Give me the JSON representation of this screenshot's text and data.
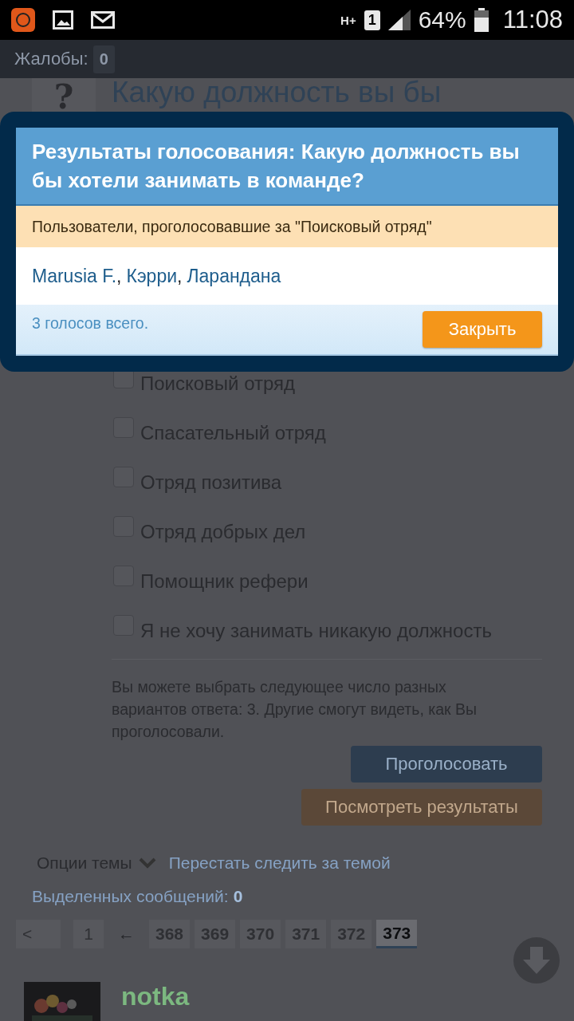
{
  "status_bar": {
    "network": "H+",
    "sim": "1",
    "battery": "64%",
    "time": "11:08"
  },
  "page": {
    "complaints_label": "Жалобы:",
    "complaints_count": "0",
    "question_mark": "?",
    "poll_question": "Какую должность вы бы",
    "options": [
      {
        "label": "Поисковый отряд",
        "checked": false
      },
      {
        "label": "Спасательный отряд",
        "checked": false
      },
      {
        "label": "Отряд позитива",
        "checked": false
      },
      {
        "label": "Отряд добрых дел",
        "checked": false
      },
      {
        "label": "Помощник рефери",
        "checked": false
      },
      {
        "label": "Я не хочу занимать никакую должность",
        "checked": false
      }
    ],
    "info": "Вы можете выбрать следующее число разных вариантов ответа: 3. Другие смогут видеть, как Вы проголосовали.",
    "vote_button": "Проголосовать",
    "results_button": "Посмотреть результаты",
    "thread_options": "Опции темы",
    "unfollow_link": "Перестать следить за темой",
    "selected_label": "Выделенных сообщений:",
    "selected_count": "0",
    "pagination": {
      "prev": "<",
      "first": "1",
      "jump": "←",
      "pages": [
        {
          "label": "368",
          "selected": false
        },
        {
          "label": "369",
          "selected": false
        },
        {
          "label": "370",
          "selected": false
        },
        {
          "label": "371",
          "selected": false
        },
        {
          "label": "372",
          "selected": false
        },
        {
          "label": "373",
          "selected": true
        }
      ]
    },
    "post_author": "notka"
  },
  "dialog": {
    "title": "Результаты голосования: Какую должность вы бы хотели занимать в команде?",
    "subtitle": "Пользователи, проголосовавшие за \"Поисковый отряд\"",
    "voters": [
      {
        "name": "Marusia F.",
        "separator": ","
      },
      {
        "name": "Кэрри",
        "separator": ","
      },
      {
        "name": "Ларандана"
      }
    ],
    "total": "3 голосов всего.",
    "close_button": "Закрыть"
  }
}
